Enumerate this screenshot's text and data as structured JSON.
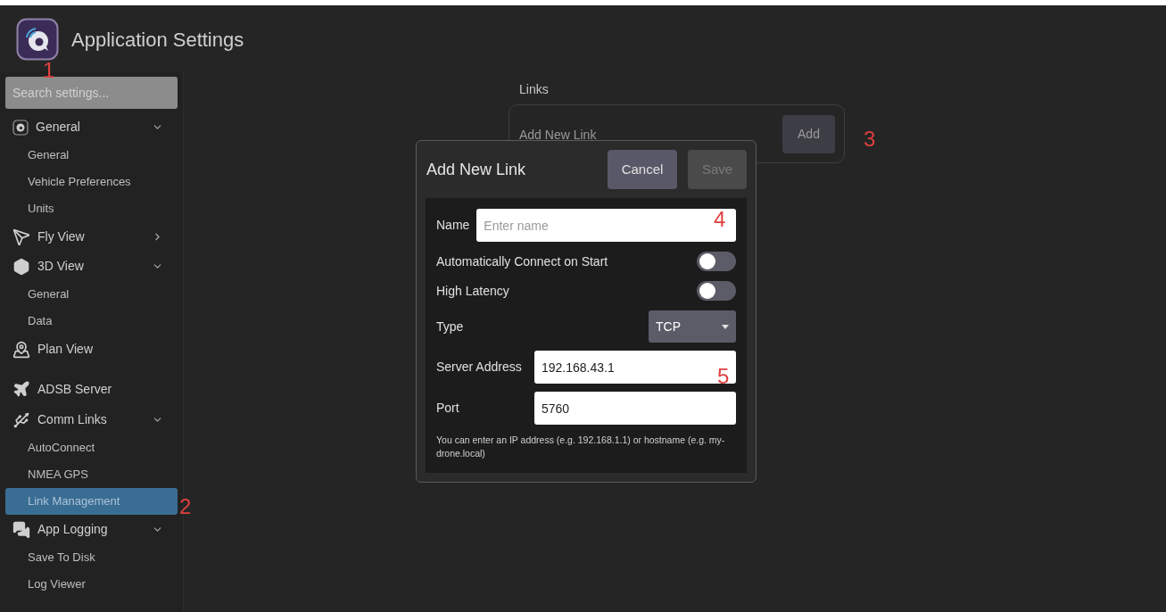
{
  "window": {
    "title": "Application Settings"
  },
  "search": {
    "placeholder": "Search settings..."
  },
  "sidebar": {
    "sections": [
      {
        "label": "General",
        "expanded": true,
        "children": [
          {
            "label": "General",
            "selected": false
          },
          {
            "label": "Vehicle Preferences",
            "selected": false
          },
          {
            "label": "Units",
            "selected": false
          }
        ]
      },
      {
        "label": "Fly View",
        "expanded": false
      },
      {
        "label": "3D View",
        "expanded": true,
        "children": [
          {
            "label": "General",
            "selected": false
          },
          {
            "label": "Data",
            "selected": false
          }
        ]
      },
      {
        "label": "Plan View"
      },
      {
        "label": "ADSB Server"
      },
      {
        "label": "Comm Links",
        "expanded": true,
        "children": [
          {
            "label": "AutoConnect",
            "selected": false
          },
          {
            "label": "NMEA GPS",
            "selected": false
          },
          {
            "label": "Link Management",
            "selected": true
          }
        ]
      },
      {
        "label": "App Logging",
        "expanded": true,
        "children": [
          {
            "label": "Save To Disk",
            "selected": false
          },
          {
            "label": "Log Viewer",
            "selected": false
          }
        ]
      }
    ]
  },
  "links": {
    "heading": "Links",
    "label": "Add New Link",
    "button": "Add"
  },
  "dialog": {
    "title": "Add New Link",
    "cancel": "Cancel",
    "save": "Save",
    "save_disabled": true,
    "name": {
      "label": "Name",
      "placeholder": "Enter name"
    },
    "toggles": [
      {
        "label": "Automatically Connect on Start",
        "on": false
      },
      {
        "label": "High Latency",
        "on": false
      }
    ],
    "type": {
      "label": "Type",
      "value": "TCP"
    },
    "server": {
      "label": "Server Address",
      "value": "192.168.43.1"
    },
    "port": {
      "label": "Port",
      "value": "5760"
    },
    "hint": "You can enter an IP address (e.g. 192.168.1.1) or hostname (e.g. my-drone.local)"
  },
  "annotations": [
    "1",
    "2",
    "3",
    "4",
    "5"
  ]
}
